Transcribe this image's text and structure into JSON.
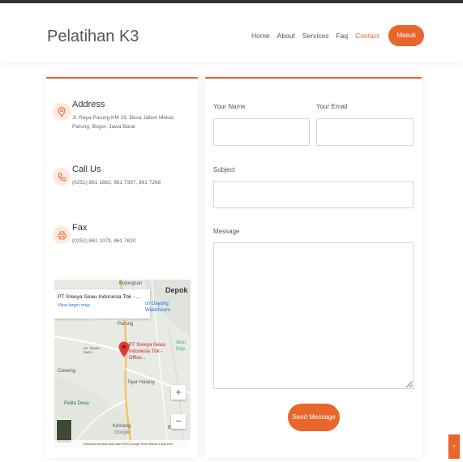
{
  "brand": "Pelatihan K3",
  "nav": {
    "items": [
      "Home",
      "About",
      "Services",
      "Faq",
      "Contact"
    ],
    "active": "Contact",
    "button": "Masuk"
  },
  "contact_info": [
    {
      "title": "Address",
      "text": "Jl. Raya Parung KM 19, Desa Jabon Mekar, Parung, Bogor, Jawa Barat",
      "icon": "map-pin-icon"
    },
    {
      "title": "Call Us",
      "text": "(0251) 861 1862, 861 7397, 861 7268",
      "icon": "phone-icon"
    },
    {
      "title": "Fax",
      "text": "(0251) 861 1079, 861 7620",
      "icon": "fax-icon"
    }
  ],
  "map": {
    "place_title": "PT Sreeya Sewu Indonesia Tbk - ...",
    "view_larger": "View larger map",
    "labels": {
      "bojongsari": "Bojongsari",
      "depok": "Depok",
      "dayung": "ch Dayung Waterboom",
      "parung": "Parung",
      "marker": "PT Sreeya Sewu Indonesia Tbk - Office...",
      "ciseeng": "Ciseeng",
      "tajur": "Tajur Halang",
      "pelita": "Pelita Desa",
      "kemang": "Kemang",
      "google": "Google",
      "bojo": "Bojo",
      "alun": "Alun Dep",
      "tanah": "KP. TANAH BARU"
    },
    "footer": "Keyboard shortcuts   Map data ©2024 Google   Terms   Report a map error",
    "zoom_in": "+",
    "zoom_out": "−"
  },
  "form": {
    "name_label": "Your Name",
    "email_label": "Your Email",
    "subject_label": "Subject",
    "message_label": "Message",
    "submit": "Send Message"
  },
  "back_to_top": "↑",
  "colors": {
    "accent": "#e8652b"
  }
}
